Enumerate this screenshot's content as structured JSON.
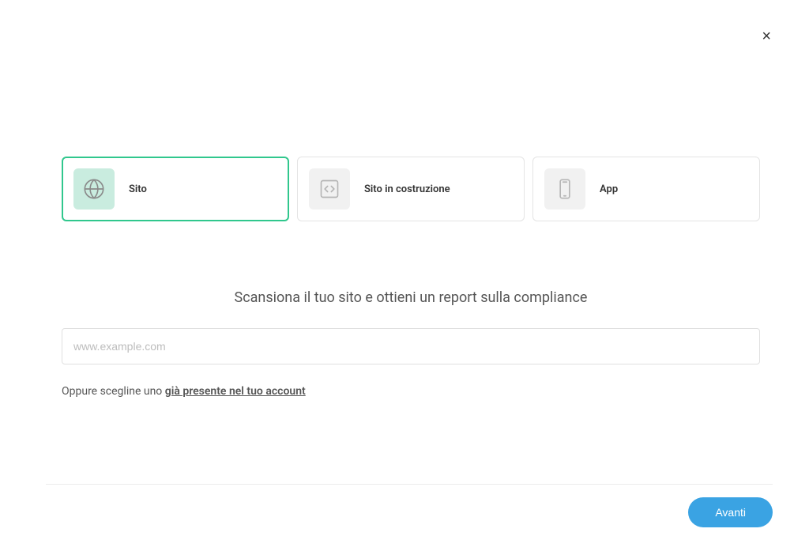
{
  "close_label": "×",
  "options": {
    "site": {
      "label": "Sito"
    },
    "construction": {
      "label": "Sito in costruzione"
    },
    "app": {
      "label": "App"
    }
  },
  "scan": {
    "title": "Scansiona il tuo sito e ottieni un report sulla compliance",
    "placeholder": "www.example.com"
  },
  "alt": {
    "prefix": "Oppure scegline uno ",
    "link": "già presente nel tuo account"
  },
  "footer": {
    "next": "Avanti"
  }
}
